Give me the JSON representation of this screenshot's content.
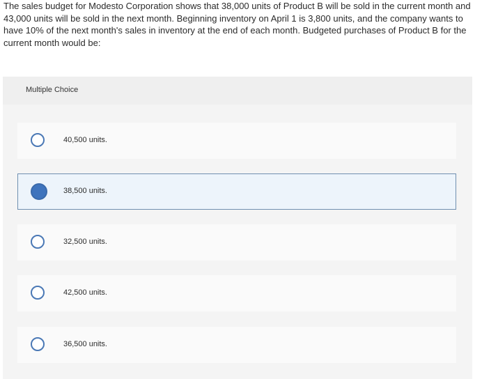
{
  "question": {
    "text": "The sales budget for Modesto Corporation shows that 38,000 units of Product B will be sold in the current month and 43,000 units will be sold in the next month. Beginning inventory on April 1 is 3,800 units, and the company wants to have 10% of the next month's sales in inventory at the end of each month. Budgeted purchases of Product B for the current month would be:"
  },
  "multiple_choice": {
    "header": "Multiple Choice",
    "options": [
      {
        "label": "40,500 units.",
        "selected": false
      },
      {
        "label": "38,500 units.",
        "selected": true
      },
      {
        "label": "32,500 units.",
        "selected": false
      },
      {
        "label": "42,500 units.",
        "selected": false
      },
      {
        "label": "36,500 units.",
        "selected": false
      }
    ]
  },
  "colors": {
    "radio_border": "#4a78b5",
    "radio_selected_fill": "#3f74bd",
    "selected_option_bg": "#edf4fb",
    "selected_option_border": "#6f8fb0",
    "panel_bg": "#f4f4f4"
  }
}
